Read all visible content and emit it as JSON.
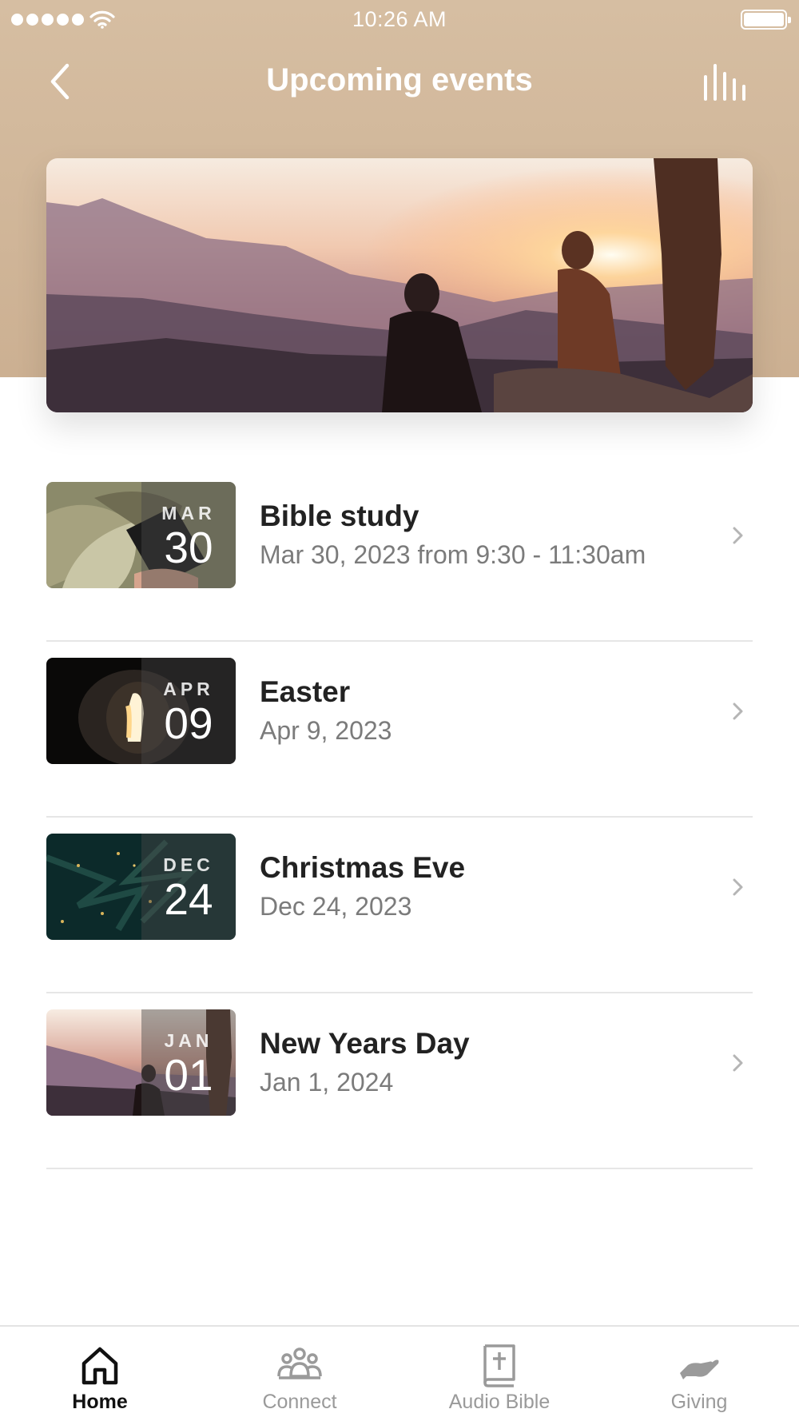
{
  "status_bar": {
    "time": "10:26 AM",
    "icons": [
      "signal-dots-icon",
      "wifi-icon",
      "battery-icon"
    ]
  },
  "nav": {
    "title": "Upcoming events",
    "back_icon": "chevron-left-icon",
    "right_icon": "bar-chart-icon"
  },
  "events": [
    {
      "month": "MAR",
      "day": "30",
      "title": "Bible study",
      "date": "Mar 30, 2023 from 9:30 - 11:30am"
    },
    {
      "month": "APR",
      "day": "09",
      "title": "Easter",
      "date": "Apr 9, 2023"
    },
    {
      "month": "DEC",
      "day": "24",
      "title": "Christmas Eve",
      "date": "Dec 24, 2023"
    },
    {
      "month": "JAN",
      "day": "01",
      "title": "New Years Day",
      "date": "Jan 1, 2024"
    }
  ],
  "tabs": [
    {
      "label": "Home",
      "icon": "home-icon",
      "active": true
    },
    {
      "label": "Connect",
      "icon": "people-icon",
      "active": false
    },
    {
      "label": "Audio Bible",
      "icon": "bible-icon",
      "active": false
    },
    {
      "label": "Giving",
      "icon": "giving-hand-icon",
      "active": false
    }
  ],
  "colors": {
    "header_bg": "#d6bea2",
    "text_primary": "#222222",
    "text_secondary": "#7b7b7b",
    "tab_active": "#111111",
    "tab_inactive": "#9a9a9a"
  }
}
